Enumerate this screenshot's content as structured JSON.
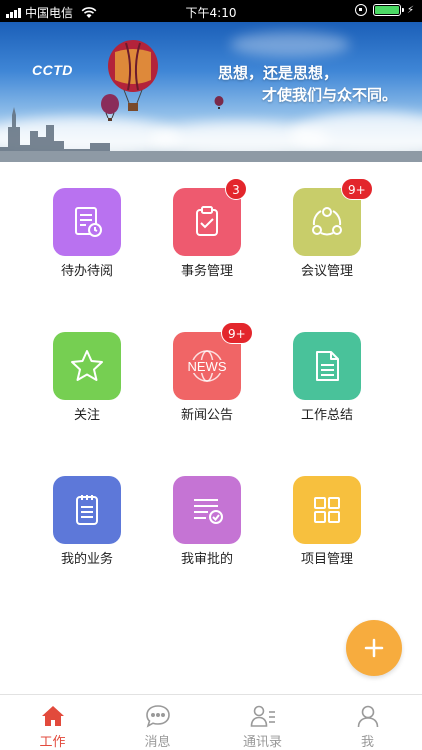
{
  "status_bar": {
    "carrier": "中国电信",
    "time": "下午4:10"
  },
  "banner": {
    "logo": "CCTD",
    "slogan_line1": "思想，还是思想，",
    "slogan_line2": "才使我们与众不同。"
  },
  "tiles": [
    {
      "label": "待办待阅",
      "icon": "document-clock-icon",
      "color": "#b972f0",
      "badge": ""
    },
    {
      "label": "事务管理",
      "icon": "clipboard-check-icon",
      "color": "#ee5a6f",
      "badge": "3"
    },
    {
      "label": "会议管理",
      "icon": "share-nodes-icon",
      "color": "#c8cd6a",
      "badge": "9+"
    },
    {
      "label": "关注",
      "icon": "star-icon",
      "color": "#76cf52",
      "badge": ""
    },
    {
      "label": "新闻公告",
      "icon": "news-globe-icon",
      "color": "#f06566",
      "badge": "9+"
    },
    {
      "label": "工作总结",
      "icon": "document-lines-icon",
      "color": "#49c29a",
      "badge": ""
    },
    {
      "label": "我的业务",
      "icon": "notepad-icon",
      "color": "#5d78d9",
      "badge": ""
    },
    {
      "label": "我审批的",
      "icon": "list-check-icon",
      "color": "#c574d4",
      "badge": ""
    },
    {
      "label": "项目管理",
      "icon": "grid-squares-icon",
      "color": "#f7c03e",
      "badge": ""
    }
  ],
  "tabbar": {
    "active_color": "#e24a3c",
    "items": [
      {
        "label": "工作",
        "icon": "home-icon",
        "active": true
      },
      {
        "label": "消息",
        "icon": "chat-bubble-icon",
        "active": false
      },
      {
        "label": "通讯录",
        "icon": "contacts-icon",
        "active": false
      },
      {
        "label": "我",
        "icon": "person-icon",
        "active": false
      }
    ]
  },
  "fab": {
    "icon": "plus-icon",
    "color": "#f7ac3e"
  }
}
